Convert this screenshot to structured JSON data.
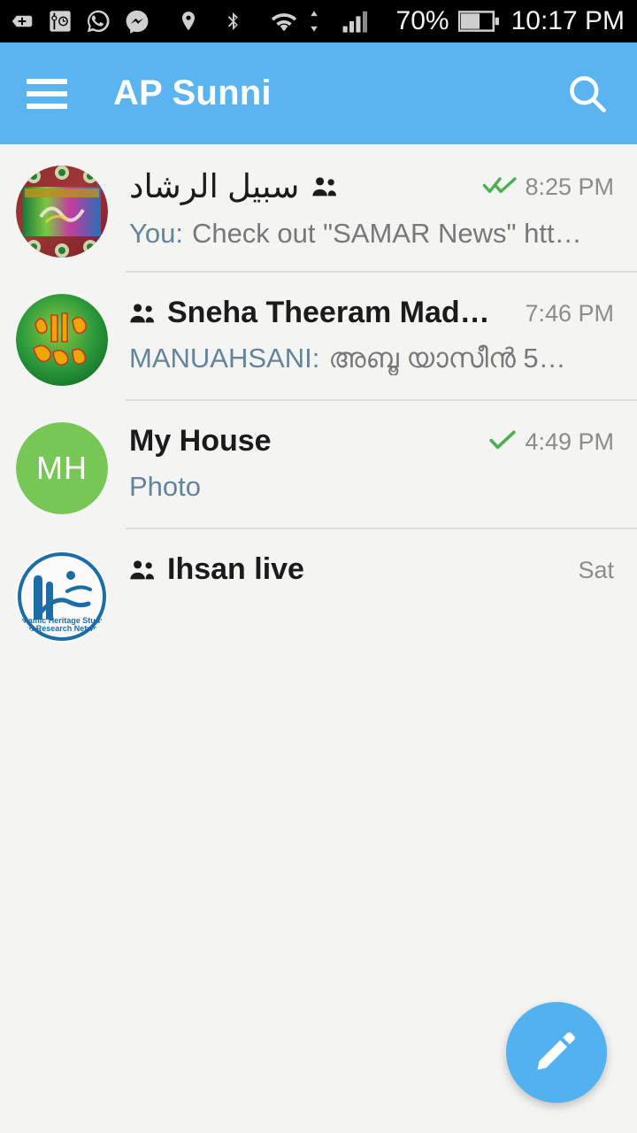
{
  "statusbar": {
    "icons": [
      {
        "name": "add-tag-icon"
      },
      {
        "name": "clock-settings-icon"
      },
      {
        "name": "whatsapp-icon"
      },
      {
        "name": "messenger-icon"
      },
      {
        "name": "location-pin-icon"
      },
      {
        "name": "bluetooth-icon"
      },
      {
        "name": "wifi-icon"
      },
      {
        "name": "data-transfer-arrows-icon"
      },
      {
        "name": "cellular-signal-icon"
      }
    ],
    "battery_percent": "70%",
    "battery_icon": "battery-icon",
    "clock": "10:17 PM"
  },
  "appbar": {
    "menu_icon": "hamburger-menu-icon",
    "title": "AP Sunni",
    "search_icon": "search-icon",
    "background_color": "#5ab4ef"
  },
  "chats": [
    {
      "title": "سبيل الرشاد",
      "is_group": true,
      "rtl": true,
      "sender": "You:",
      "preview": "Check out \"SAMAR News\" htt…",
      "timestamp": "8:25 PM",
      "status": "read",
      "avatar_type": "image",
      "avatar_label": "sabeel-al-rashad-avatar"
    },
    {
      "title": "Sneha Theeram Mad…",
      "is_group": true,
      "rtl": false,
      "sender": "MANUAHSANI:",
      "preview": "അബൂ യാസീൻ 5…",
      "timestamp": "7:46 PM",
      "status": "none",
      "avatar_type": "image",
      "avatar_label": "hubbu-rasool-avatar"
    },
    {
      "title": "My House",
      "is_group": false,
      "rtl": false,
      "sender": "",
      "preview": "Photo",
      "timestamp": "4:49 PM",
      "status": "sent",
      "avatar_type": "initials",
      "avatar_initials": "MH",
      "avatar_color": "#76c756"
    },
    {
      "title": "Ihsan live",
      "is_group": true,
      "rtl": false,
      "sender": "",
      "preview": "",
      "timestamp": "Sat",
      "status": "none",
      "avatar_type": "image",
      "avatar_label": "ihsan-logo-avatar"
    }
  ],
  "fab": {
    "icon": "compose-pencil-icon",
    "color": "#52b2ef"
  },
  "colors": {
    "accent": "#5ab4ef",
    "background": "#f4f4f2",
    "check_green": "#4caf50",
    "sender_blue": "#63849b"
  }
}
